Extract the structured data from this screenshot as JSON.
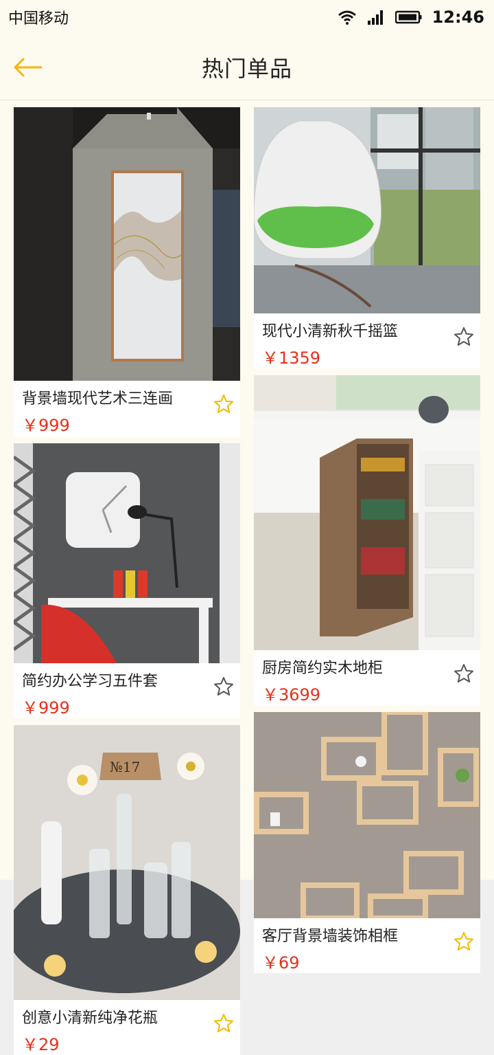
{
  "status_bar": {
    "carrier": "中国移动",
    "time": "12:46"
  },
  "nav": {
    "title": "热门单品",
    "back_icon": "arrow-left-icon"
  },
  "colors": {
    "accent": "#f5b800",
    "price": "#e8301a",
    "background": "#fdfaf0"
  },
  "products": [
    {
      "name": "背景墙现代艺术三连画",
      "price": "￥999",
      "favorited": true
    },
    {
      "name": "现代小清新秋千摇篮",
      "price": "￥1359",
      "favorited": false
    },
    {
      "name": "简约办公学习五件套",
      "price": "￥999",
      "favorited": false
    },
    {
      "name": "厨房简约实木地柜",
      "price": "￥3699",
      "favorited": false
    },
    {
      "name": "创意小清新纯净花瓶",
      "price": "￥29",
      "favorited": true
    },
    {
      "name": "客厅背景墙装饰相框",
      "price": "￥69",
      "favorited": true
    }
  ],
  "image_texts": {
    "vase_tag": "№17"
  }
}
